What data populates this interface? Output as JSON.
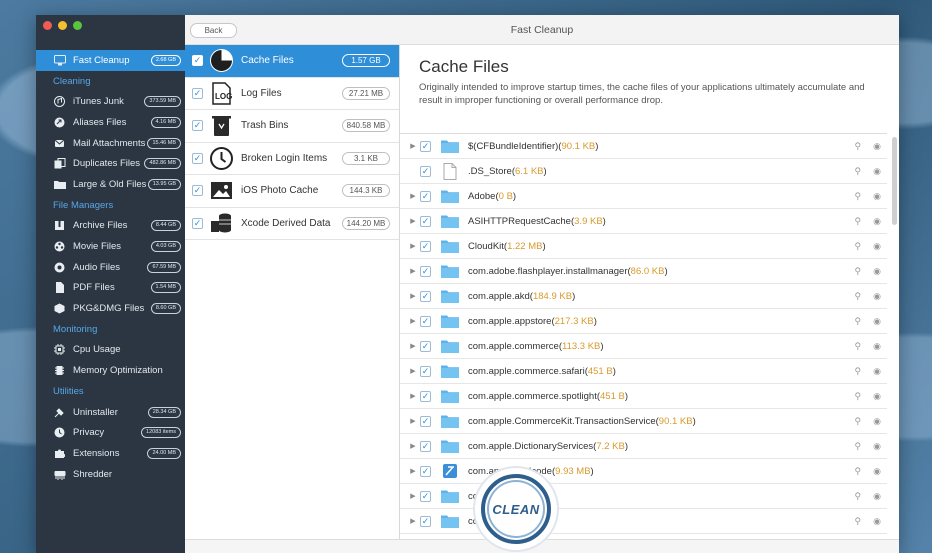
{
  "window": {
    "title": "Fast Cleanup",
    "back_label": "Back"
  },
  "sidebar": {
    "active": {
      "label": "Fast Cleanup",
      "badge": "2.68 GB",
      "icon": "monitor-icon"
    },
    "sections": [
      {
        "title": "Cleaning",
        "items": [
          {
            "label": "iTunes Junk",
            "badge": "373.59 MB",
            "icon": "music-icon"
          },
          {
            "label": "Aliases Files",
            "badge": "4.16 MB",
            "icon": "alias-icon"
          },
          {
            "label": "Mail Attachments",
            "badge": "15.46 MB",
            "icon": "paperclip-icon"
          },
          {
            "label": "Duplicates Files",
            "badge": "482.86 MB",
            "icon": "duplicate-icon"
          },
          {
            "label": "Large & Old Files",
            "badge": "13.95 GB",
            "icon": "folder-icon"
          }
        ]
      },
      {
        "title": "File Managers",
        "items": [
          {
            "label": "Archive Files",
            "badge": "8.44 GB",
            "icon": "archive-icon"
          },
          {
            "label": "Movie Files",
            "badge": "4.03 GB",
            "icon": "film-icon"
          },
          {
            "label": "Audio Files",
            "badge": "67.59 MB",
            "icon": "audio-icon"
          },
          {
            "label": "PDF Files",
            "badge": "1.54 MB",
            "icon": "pdf-icon"
          },
          {
            "label": "PKG&DMG Files",
            "badge": "8.60 GB",
            "icon": "package-icon"
          }
        ]
      },
      {
        "title": "Monitoring",
        "items": [
          {
            "label": "Cpu Usage",
            "badge": "",
            "icon": "cpu-icon"
          },
          {
            "label": "Memory Optimization",
            "badge": "",
            "icon": "memory-icon"
          }
        ]
      },
      {
        "title": "Utilities",
        "items": [
          {
            "label": "Uninstaller",
            "badge": "28.34 GB",
            "icon": "uninstall-icon"
          },
          {
            "label": "Privacy",
            "badge": "12083 items",
            "icon": "privacy-icon"
          },
          {
            "label": "Extensions",
            "badge": "24.00 MB",
            "icon": "puzzle-icon"
          },
          {
            "label": "Shredder",
            "badge": "",
            "icon": "shredder-icon"
          }
        ]
      }
    ]
  },
  "middle": {
    "items": [
      {
        "label": "Cache Files",
        "size": "1.57 GB",
        "icon": "pie-chart-icon",
        "active": true
      },
      {
        "label": "Log Files",
        "size": "27.21 MB",
        "icon": "log-icon"
      },
      {
        "label": "Trash Bins",
        "size": "840.58 MB",
        "icon": "trash-icon"
      },
      {
        "label": "Broken Login Items",
        "size": "3.1 KB",
        "icon": "broken-login-icon"
      },
      {
        "label": "iOS Photo Cache",
        "size": "144.3 KB",
        "icon": "photo-icon"
      },
      {
        "label": "Xcode Derived Data",
        "size": "144.20 MB",
        "icon": "database-icon"
      }
    ]
  },
  "detail": {
    "title": "Cache Files",
    "description": "Originally intended to improve startup times, the cache files of your applications ultimately accumulate and result in improper functioning or overall performance drop.",
    "files": [
      {
        "name": "$(CFBundleIdentifier)",
        "size": "90.1 KB",
        "type": "folder",
        "expandable": true
      },
      {
        "name": ".DS_Store",
        "size": "6.1 KB",
        "type": "file",
        "expandable": false
      },
      {
        "name": "Adobe",
        "size": "0 B",
        "type": "folder",
        "expandable": true
      },
      {
        "name": "ASIHTTPRequestCache",
        "size": "3.9 KB",
        "type": "folder",
        "expandable": true
      },
      {
        "name": "CloudKit",
        "size": "1.22 MB",
        "type": "folder",
        "expandable": true
      },
      {
        "name": "com.adobe.flashplayer.installmanager",
        "size": "86.0 KB",
        "type": "folder",
        "expandable": true
      },
      {
        "name": "com.apple.akd",
        "size": "184.9 KB",
        "type": "folder",
        "expandable": true
      },
      {
        "name": "com.apple.appstore",
        "size": "217.3 KB",
        "type": "folder",
        "expandable": true
      },
      {
        "name": "com.apple.commerce",
        "size": "113.3 KB",
        "type": "folder",
        "expandable": true
      },
      {
        "name": "com.apple.commerce.safari",
        "size": "451 B",
        "type": "folder",
        "expandable": true
      },
      {
        "name": "com.apple.commerce.spotlight",
        "size": "451 B",
        "type": "folder",
        "expandable": true
      },
      {
        "name": "com.apple.CommerceKit.TransactionService",
        "size": "90.1 KB",
        "type": "folder",
        "expandable": true
      },
      {
        "name": "com.apple.DictionaryServices",
        "size": "7.2 KB",
        "type": "folder",
        "expandable": true
      },
      {
        "name": "com.apple.dt.Xcode",
        "size": "9.93 MB",
        "type": "xcode",
        "expandable": true
      },
      {
        "name": "com.apple.fin",
        "size": "",
        "type": "folder",
        "expandable": true
      },
      {
        "name": "com.apple",
        "size": "",
        "type": "folder",
        "expandable": true
      }
    ],
    "clean_label": "CLEAN"
  }
}
